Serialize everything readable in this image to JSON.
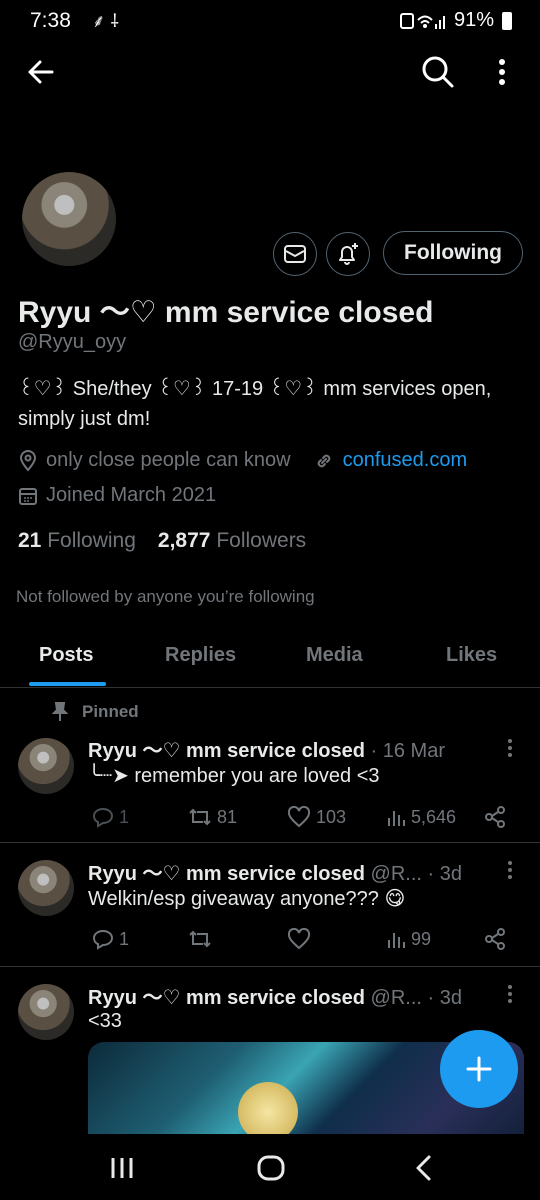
{
  "status_bar": {
    "time": "7:38",
    "left_icons": "⸙ ⸸",
    "battery": "91%"
  },
  "header": {
    "back_icon": "arrow-left-icon",
    "search_icon": "search-icon",
    "more_icon": "more-vertical-icon"
  },
  "profile": {
    "display_name": "Ryyu ～♡ mm service closed",
    "handle": "@Ryyu_oyy",
    "bio": "꒰♡꒱ She/they ꒰♡꒱ 17-19 ꒰♡꒱ mm services open, simply just dm!",
    "location": "only close people can know",
    "website": "confused.com",
    "joined": "Joined March 2021",
    "following_count": "21",
    "following_label": "Following",
    "followers_count": "2,877",
    "followers_label": "Followers",
    "not_followed": "Not followed by anyone you’re following",
    "follow_button": "Following"
  },
  "tabs": [
    {
      "label": "Posts",
      "active": true
    },
    {
      "label": "Replies",
      "active": false
    },
    {
      "label": "Media",
      "active": false
    },
    {
      "label": "Likes",
      "active": false
    }
  ],
  "pinned_label": "Pinned",
  "posts": [
    {
      "name": "Ryyu ～♡ mm service closed",
      "meta": " · 16 Mar",
      "text": "╰┈➤ remember you are loved <3",
      "replies": "1",
      "reposts": "81",
      "likes": "103",
      "views": "5,646"
    },
    {
      "name": "Ryyu ～♡ mm service closed",
      "meta": " @R... · 3d",
      "text": "Welkin/esp giveaway anyone??? 😋",
      "replies": "1",
      "reposts": "",
      "likes": "",
      "views": "99"
    },
    {
      "name": "Ryyu ～♡ mm service closed",
      "meta": " @R... · 3d",
      "text": "<33"
    }
  ],
  "colors": {
    "accent": "#1d9bf0",
    "muted": "#71767b",
    "border": "#2f3336"
  }
}
